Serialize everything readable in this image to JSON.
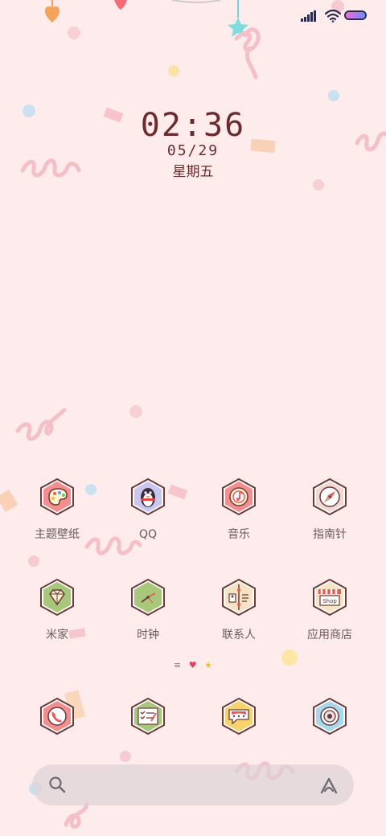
{
  "status_bar": {
    "signal_icon": "signal-bars-icon",
    "wifi_icon": "wifi-icon",
    "battery_icon": "battery-icon",
    "battery_level": 1.0
  },
  "lock_clock": {
    "time": "02:36",
    "date": "05/29",
    "weekday": "星期五"
  },
  "apps_row1": [
    {
      "label": "主题壁纸",
      "icon": "palette-icon"
    },
    {
      "label": "QQ",
      "icon": "penguin-icon"
    },
    {
      "label": "音乐",
      "icon": "music-note-icon"
    },
    {
      "label": "指南针",
      "icon": "compass-icon"
    }
  ],
  "apps_row2": [
    {
      "label": "米家",
      "icon": "diamond-icon"
    },
    {
      "label": "时钟",
      "icon": "clock-icon"
    },
    {
      "label": "联系人",
      "icon": "contacts-icon"
    },
    {
      "label": "应用商店",
      "icon": "shop-icon"
    }
  ],
  "page_indicator": {
    "menu_glyph": "≡",
    "heart_glyph": "♥",
    "star_glyph": "★"
  },
  "dock": [
    {
      "icon": "phone-icon"
    },
    {
      "icon": "notes-checklist-icon"
    },
    {
      "icon": "message-bubble-icon"
    },
    {
      "icon": "camera-icon"
    }
  ],
  "search_bar": {
    "search_icon": "search-icon",
    "assistant_icon": "assistant-a-icon"
  },
  "colors": {
    "background": "#fdeceb",
    "clock_text": "#6b2a2d",
    "label_text": "#6d5a5a"
  }
}
